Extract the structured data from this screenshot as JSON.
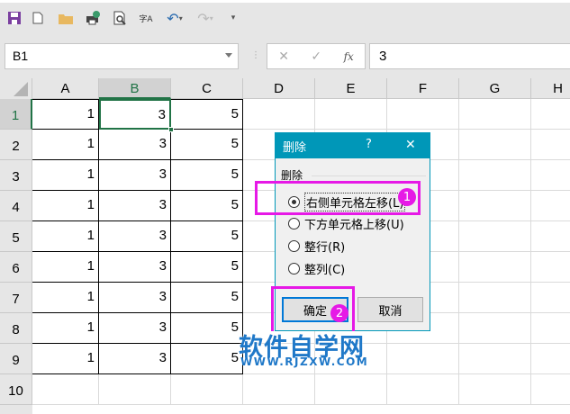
{
  "toolbar": {
    "items": [
      "save-icon",
      "new-icon",
      "open-icon",
      "print-icon",
      "print-preview-icon",
      "spellcheck-icon",
      "undo-icon",
      "redo-icon",
      "customize-icon"
    ],
    "spell_label": "字A"
  },
  "formula_bar": {
    "name_box": "B1",
    "cancel": "✕",
    "enter": "✓",
    "fx": "fx",
    "value": "3"
  },
  "columns": [
    "A",
    "B",
    "C",
    "D",
    "E",
    "F",
    "G",
    "H"
  ],
  "rows": [
    "1",
    "2",
    "3",
    "4",
    "5",
    "6",
    "7",
    "8",
    "9",
    "10"
  ],
  "cells": {
    "rows": [
      [
        "1",
        "3",
        "5"
      ],
      [
        "1",
        "3",
        "5"
      ],
      [
        "1",
        "3",
        "5"
      ],
      [
        "1",
        "3",
        "5"
      ],
      [
        "1",
        "3",
        "5"
      ],
      [
        "1",
        "3",
        "5"
      ],
      [
        "1",
        "3",
        "5"
      ],
      [
        "1",
        "3",
        "5"
      ],
      [
        "1",
        "3",
        "5"
      ]
    ]
  },
  "dialog": {
    "title": "删除",
    "help": "?",
    "close": "✕",
    "group": "删除",
    "options": [
      "右侧单元格左移(L)",
      "下方单元格上移(U)",
      "整行(R)",
      "整列(C)"
    ],
    "ok": "确定",
    "cancel": "取消"
  },
  "annotations": {
    "badge1": "1",
    "badge2": "2"
  },
  "watermark": {
    "title": "软件自学网",
    "url": "WWW.RJZXW.COM"
  },
  "colors": {
    "accent": "#0097b8",
    "selection": "#217346",
    "highlight": "#e619e6"
  }
}
